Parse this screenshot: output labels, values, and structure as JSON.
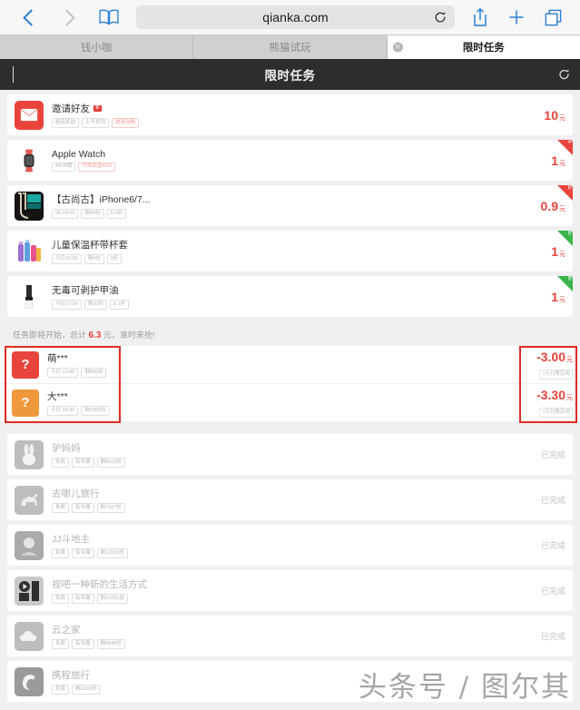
{
  "browser": {
    "url": "qianka.com",
    "back_icon": "chevron-left-icon",
    "forward_icon": "chevron-right-icon",
    "bookmarks_icon": "book-icon",
    "reload_icon": "reload-icon",
    "share_icon": "share-icon",
    "newtab_icon": "plus-icon",
    "tabs_icon": "tabs-icon",
    "tabs": [
      {
        "label": "钱小咖",
        "active": false,
        "closable": false
      },
      {
        "label": "熊猫试玩",
        "active": false,
        "closable": false
      },
      {
        "label": "限时任务",
        "active": true,
        "closable": true
      }
    ]
  },
  "app_header": {
    "title": "限时任务",
    "back_icon": "chevron-left-icon",
    "refresh_icon": "refresh-icon"
  },
  "tasks": [
    {
      "title": "邀请好友",
      "title_badge": "新",
      "tags": [
        {
          "text": "超高奖励",
          "style": "grey"
        },
        {
          "text": "上不封顶",
          "style": "grey"
        },
        {
          "text": "邀请攻略",
          "style": "pink"
        }
      ],
      "price": "10",
      "unit": "元",
      "corner": null,
      "corner_label": "",
      "thumb_icon": "envelope-icon",
      "thumb_bg": "#e8443c"
    },
    {
      "title": "Apple Watch",
      "title_badge": "",
      "tags": [
        {
          "text": "A436期",
          "style": "grey"
        },
        {
          "text": "开奖后返41%",
          "style": "pink"
        }
      ],
      "price": "1",
      "unit": "元",
      "corner": "red",
      "corner_label": "中",
      "thumb_icon": "watch-icon",
      "thumb_bg": "#ffffff"
    },
    {
      "title": "【古尚古】iPhone6/7...",
      "title_badge": "",
      "tags": [
        {
          "text": "00:29:06",
          "style": "grey"
        },
        {
          "text": "剩60份",
          "style": "grey"
        },
        {
          "text": "3.6折",
          "style": "grey"
        }
      ],
      "price": "0.9",
      "unit": "元",
      "corner": "red",
      "corner_label": "抢",
      "thumb_icon": "cable-icon",
      "thumb_bg": "#1d1d1d"
    },
    {
      "title": "儿童保温杯带杯套",
      "title_badge": "",
      "tags": [
        {
          "text": "今日16:00",
          "style": "grey"
        },
        {
          "text": "限4份",
          "style": "grey"
        },
        {
          "text": "9折",
          "style": "grey"
        }
      ],
      "price": "1",
      "unit": "元",
      "corner": "green",
      "corner_label": "售",
      "thumb_icon": "cup-icon",
      "thumb_bg": "#ffffff"
    },
    {
      "title": "无毒可剥护甲油",
      "title_badge": "",
      "tags": [
        {
          "text": "今日17:00",
          "style": "grey"
        },
        {
          "text": "限30份",
          "style": "grey"
        },
        {
          "text": "8.1折",
          "style": "grey"
        }
      ],
      "price": "1",
      "unit": "元",
      "corner": "green",
      "corner_label": "售",
      "thumb_icon": "polish-icon",
      "thumb_bg": "#ffffff"
    }
  ],
  "summary": {
    "prefix": "任务即将开始，总计 ",
    "amount": "6.3",
    "suffix": " 元，准时来抢!"
  },
  "highlighted_users": [
    {
      "name": "萌***",
      "tags": [
        {
          "text": "今日 13:45",
          "style": "grey"
        },
        {
          "text": "剩800份",
          "style": "grey"
        }
      ],
      "amount": "-3.00",
      "unit": "元",
      "note": "1元付费后用",
      "avatar_icon": "question-mark-icon",
      "avatar_bg": "#e8443c"
    },
    {
      "name": "大***",
      "tags": [
        {
          "text": "今日 16:00",
          "style": "grey"
        },
        {
          "text": "剩5000份",
          "style": "grey"
        }
      ],
      "amount": "-3.30",
      "unit": "元",
      "note": "1元付费后用",
      "avatar_icon": "question-mark-icon",
      "avatar_bg": "#f0993c"
    }
  ],
  "completed": [
    {
      "title": "驴妈妈",
      "tags": [
        {
          "text": "免费",
          "style": "grey"
        },
        {
          "text": "有专属",
          "style": "grey"
        },
        {
          "text": "剩8010份",
          "style": "grey"
        }
      ],
      "status": "已完成",
      "thumb_icon": "rabbit-icon"
    },
    {
      "title": "去哪儿旅行",
      "tags": [
        {
          "text": "免费",
          "style": "grey"
        },
        {
          "text": "有专属",
          "style": "grey"
        },
        {
          "text": "剩7427份",
          "style": "grey"
        }
      ],
      "status": "已完成",
      "thumb_icon": "camel-icon"
    },
    {
      "title": "JJ斗地主",
      "tags": [
        {
          "text": "免费",
          "style": "grey"
        },
        {
          "text": "有专属",
          "style": "grey"
        },
        {
          "text": "剩12193份",
          "style": "grey"
        }
      ],
      "status": "已完成",
      "thumb_icon": "cards-icon"
    },
    {
      "title": "视吧一种新的生活方式",
      "tags": [
        {
          "text": "免费",
          "style": "grey"
        },
        {
          "text": "有专属",
          "style": "grey"
        },
        {
          "text": "剩10201份",
          "style": "grey"
        }
      ],
      "status": "已完成",
      "thumb_icon": "video-icon"
    },
    {
      "title": "云之家",
      "tags": [
        {
          "text": "免费",
          "style": "grey"
        },
        {
          "text": "有专属",
          "style": "grey"
        },
        {
          "text": "剩8840份",
          "style": "grey"
        }
      ],
      "status": "已完成",
      "thumb_icon": "cloud-icon"
    },
    {
      "title": "携程旅行",
      "tags": [
        {
          "text": "免费",
          "style": "grey"
        },
        {
          "text": "剩1000份",
          "style": "grey"
        }
      ],
      "status": "",
      "thumb_icon": "ctrip-icon"
    }
  ],
  "watermark": "头条号 / 图尔其",
  "colors": {
    "accent_red": "#e8443c",
    "accent_green": "#39b54a",
    "highlight_box": "#e02b22",
    "header_bg": "#2d2d2d"
  }
}
